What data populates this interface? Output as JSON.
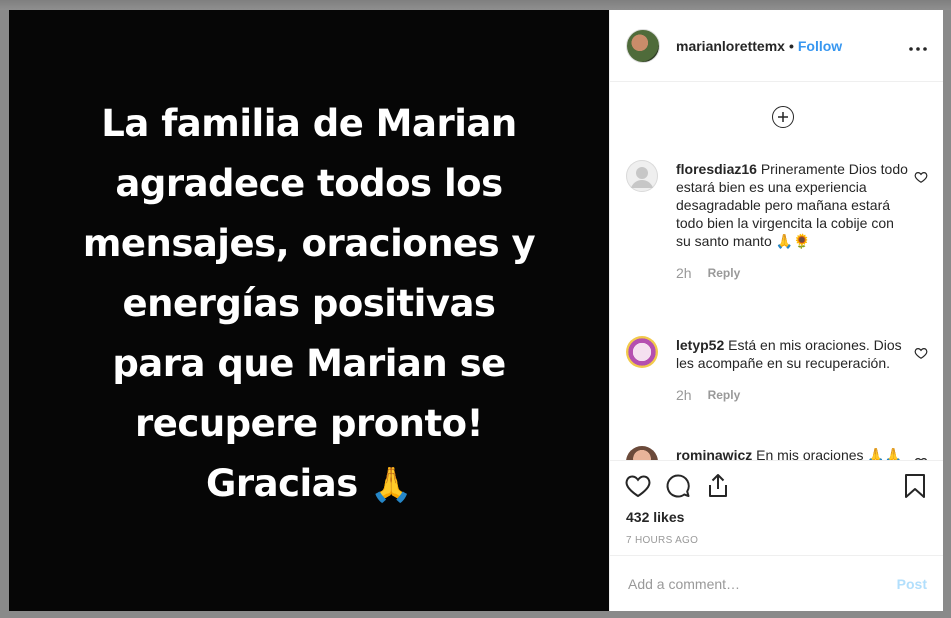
{
  "post": {
    "image_text_lines": [
      "La familia de Marian",
      "agradece todos los",
      "mensajes, oraciones y",
      "energías positivas",
      "para que Marian se",
      "recupere pronto!",
      "Gracias"
    ],
    "image_emoji": "🙏"
  },
  "header": {
    "username": "marianlorettemx",
    "separator": "•",
    "follow_label": "Follow",
    "more_label": "•••"
  },
  "comments": [
    {
      "username": "floresdiaz16",
      "text": "Prineramente Dios todo estará bien es una experiencia desagradable pero mañana estará todo bien la virgencita la cobije con su santo manto 🙏🌻",
      "time": "2h",
      "reply_label": "Reply"
    },
    {
      "username": "letyp52",
      "text": "Está en mis oraciones. Dios les acompañe en su recuperación.",
      "time": "2h",
      "reply_label": "Reply"
    },
    {
      "username": "rominawicz",
      "text": "En mis oraciones 🙏🙏",
      "time": "",
      "reply_label": ""
    }
  ],
  "load_more_label": "+",
  "likes": "432 likes",
  "time_ago": "7 HOURS AGO",
  "add_comment": {
    "placeholder": "Add a comment…",
    "post_label": "Post"
  },
  "colors": {
    "accent": "#3897f0",
    "post_disabled": "#b2dffc",
    "muted": "#999999"
  },
  "icons": [
    "heart-icon",
    "comment-icon",
    "share-icon",
    "bookmark-icon",
    "add-circle-icon",
    "more-icon"
  ]
}
